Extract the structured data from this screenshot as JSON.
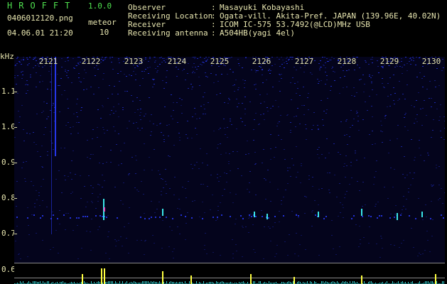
{
  "header": {
    "app_title": "HROFFT",
    "app_version": "1.0.0",
    "filename": "0406012120.png",
    "datetime": "04.06.01 21:20",
    "count_label": "meteor",
    "count_value": "10"
  },
  "info": [
    {
      "key": "Observer",
      "sep": ":",
      "value": "Masayuki Kobayashi"
    },
    {
      "key": "Receiving Location",
      "sep": ":",
      "value": "Ogata-vill. Akita-Pref. JAPAN (139.96E, 40.02N)"
    },
    {
      "key": "Receiver",
      "sep": ":",
      "value": "ICOM IC-575 53.7492(@LCD)MHz USB"
    },
    {
      "key": "Receiving antenna",
      "sep": ":",
      "value": "A504HB(yagi 4el)"
    }
  ],
  "axis": {
    "y_unit": "kHz",
    "y_ticks": [
      "1.1",
      "1.0",
      "0.9",
      "0.8",
      "0.7",
      "0.6"
    ],
    "x_ticks": [
      "2121",
      "2122",
      "2123",
      "2124",
      "2125",
      "2126",
      "2127",
      "2128",
      "2129",
      "2130"
    ]
  },
  "colors": {
    "background": "#000000",
    "spectrogram_bg": "#04041c",
    "text": "#e8e6b0",
    "title": "#4fe04f",
    "signal": "#2a3cff",
    "signal_strong": "#40ffff",
    "event": "#ffff40"
  }
}
